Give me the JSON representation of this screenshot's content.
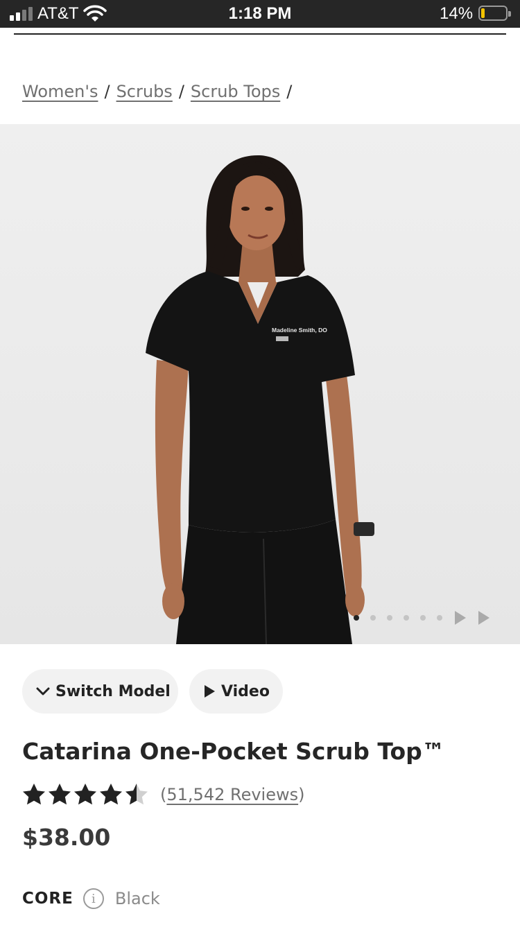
{
  "status_bar": {
    "carrier": "AT&T",
    "time": "1:18 PM",
    "battery_percent": "14%",
    "battery_level": 0.14,
    "signal_bars": 2,
    "icons": [
      "signal-icon",
      "wifi-icon",
      "battery-icon"
    ]
  },
  "breadcrumb": {
    "items": [
      "Women's",
      "Scrubs",
      "Scrub Tops"
    ],
    "separator": "/"
  },
  "gallery": {
    "name_tag": "Madeline Smith, DO",
    "slide_count": 6,
    "active_slide": 1
  },
  "actions": {
    "switch_model": "Switch Model",
    "video": "Video"
  },
  "product": {
    "title": "Catarina One-Pocket Scrub Top™",
    "rating": 4.5,
    "reviews_open": "(",
    "reviews_count": "51,542 Reviews",
    "reviews_close": ")",
    "price": "$38.00",
    "collection": "CORE",
    "color": "Black"
  },
  "colors": {
    "status_bar_bg": "#262626",
    "battery_fill": "#f3c300",
    "text_muted": "#707070",
    "pill_bg": "#f2f2f2"
  }
}
